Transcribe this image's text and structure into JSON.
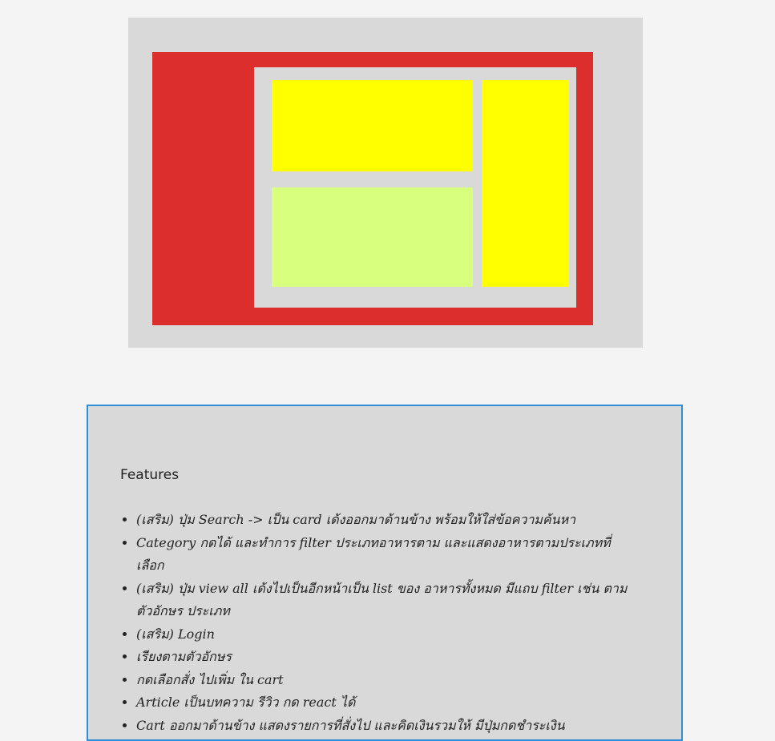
{
  "wireframe": {
    "colors": {
      "background": "#d9d9d9",
      "sidebar_frame": "#dd2e2e",
      "panel": "#d9d9d9",
      "highlight_block": "#ffff00",
      "secondary_block": "#d8ff7e"
    }
  },
  "features": {
    "title": "Features",
    "border_color": "#2e8fd6",
    "items": [
      "(เสริม) ปุ่ม Search -> เป็น card เด้งออกมาด้านข้าง พร้อมให้ใส่ข้อความค้นหา",
      "Category กดได้ และทำการ filter ประเภทอาหารตาม และแสดงอาหารตามประเภทที่เลือก",
      "(เสริม) ปุ่ม view all เด้งไปเป็นอีกหน้าเป็น list ของ อาหารทั้งหมด มีแถบ filter เช่น ตามตัวอักษร ประเภท",
      "(เสริม) Login",
      "เรียงตามตัวอักษร",
      "กดเลือกสั่ง ไปเพิ่ม ใน cart",
      "Article เป็นบทความ รีวิว กด react ได้",
      "Cart ออกมาด้านข้าง แสดงรายการที่สั่งไป และคิดเงินรวมให้ มีปุ่มกดชำระเงิน"
    ]
  }
}
